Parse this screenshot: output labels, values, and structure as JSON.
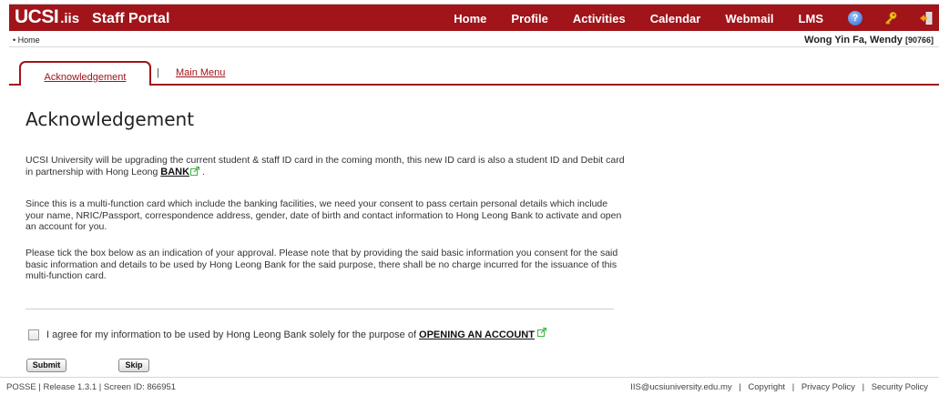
{
  "brand": {
    "ucsi": "UCSI",
    "iis": ".iis",
    "portal": "Staff Portal"
  },
  "nav": {
    "home": "Home",
    "profile": "Profile",
    "activities": "Activities",
    "calendar": "Calendar",
    "webmail": "Webmail",
    "lms": "LMS",
    "help_glyph": "?"
  },
  "breadcrumb": {
    "home": "• Home"
  },
  "user": {
    "name": "Wong Yin Fa, Wendy ",
    "id": "[90766]"
  },
  "tabs": {
    "active": "Acknowledgement",
    "separator": "|",
    "menu": "Main Menu"
  },
  "content": {
    "title": "Acknowledgement",
    "p1_text": "UCSI University will be upgrading the current student & staff ID card in the coming month, this new ID card is also a student ID and Debit card in partnership with Hong Leong ",
    "p1_link": "BANK",
    "p1_end": " .",
    "p2": "Since this is a multi-function card which include the banking facilities, we need your consent to pass certain personal details which include your name, NRIC/Passport, correspondence address, gender, date of birth and contact information to Hong Leong Bank to activate and open an account for you.",
    "p3": "Please tick the box below as an indication of your approval. Please note that by providing the said basic information you consent for the said basic information and details to be used by Hong Leong Bank for the said purpose, there shall be no charge incurred for the issuance of this multi-function card.",
    "agree_text": "I agree for my information to be used by Hong Leong Bank solely for the purpose of",
    "agree_link": "OPENING AN ACCOUNT",
    "agree_checked": false
  },
  "buttons": {
    "submit": "Submit",
    "skip": "Skip"
  },
  "footer": {
    "left": "POSSE | Release 1.3.1 | Screen ID: 866951",
    "email": "IIS@ucsiuniversity.edu.my",
    "copyright": "Copyright",
    "privacy": "Privacy Policy",
    "security": "Security Policy",
    "separator": "|"
  },
  "colors": {
    "brand_red": "#a0141a",
    "background": "#ffffff",
    "link_green": "#3fb53f"
  },
  "icons": {
    "help": "help-icon",
    "key": "key-icon",
    "logout": "logout-icon",
    "external": "external-link-icon"
  }
}
